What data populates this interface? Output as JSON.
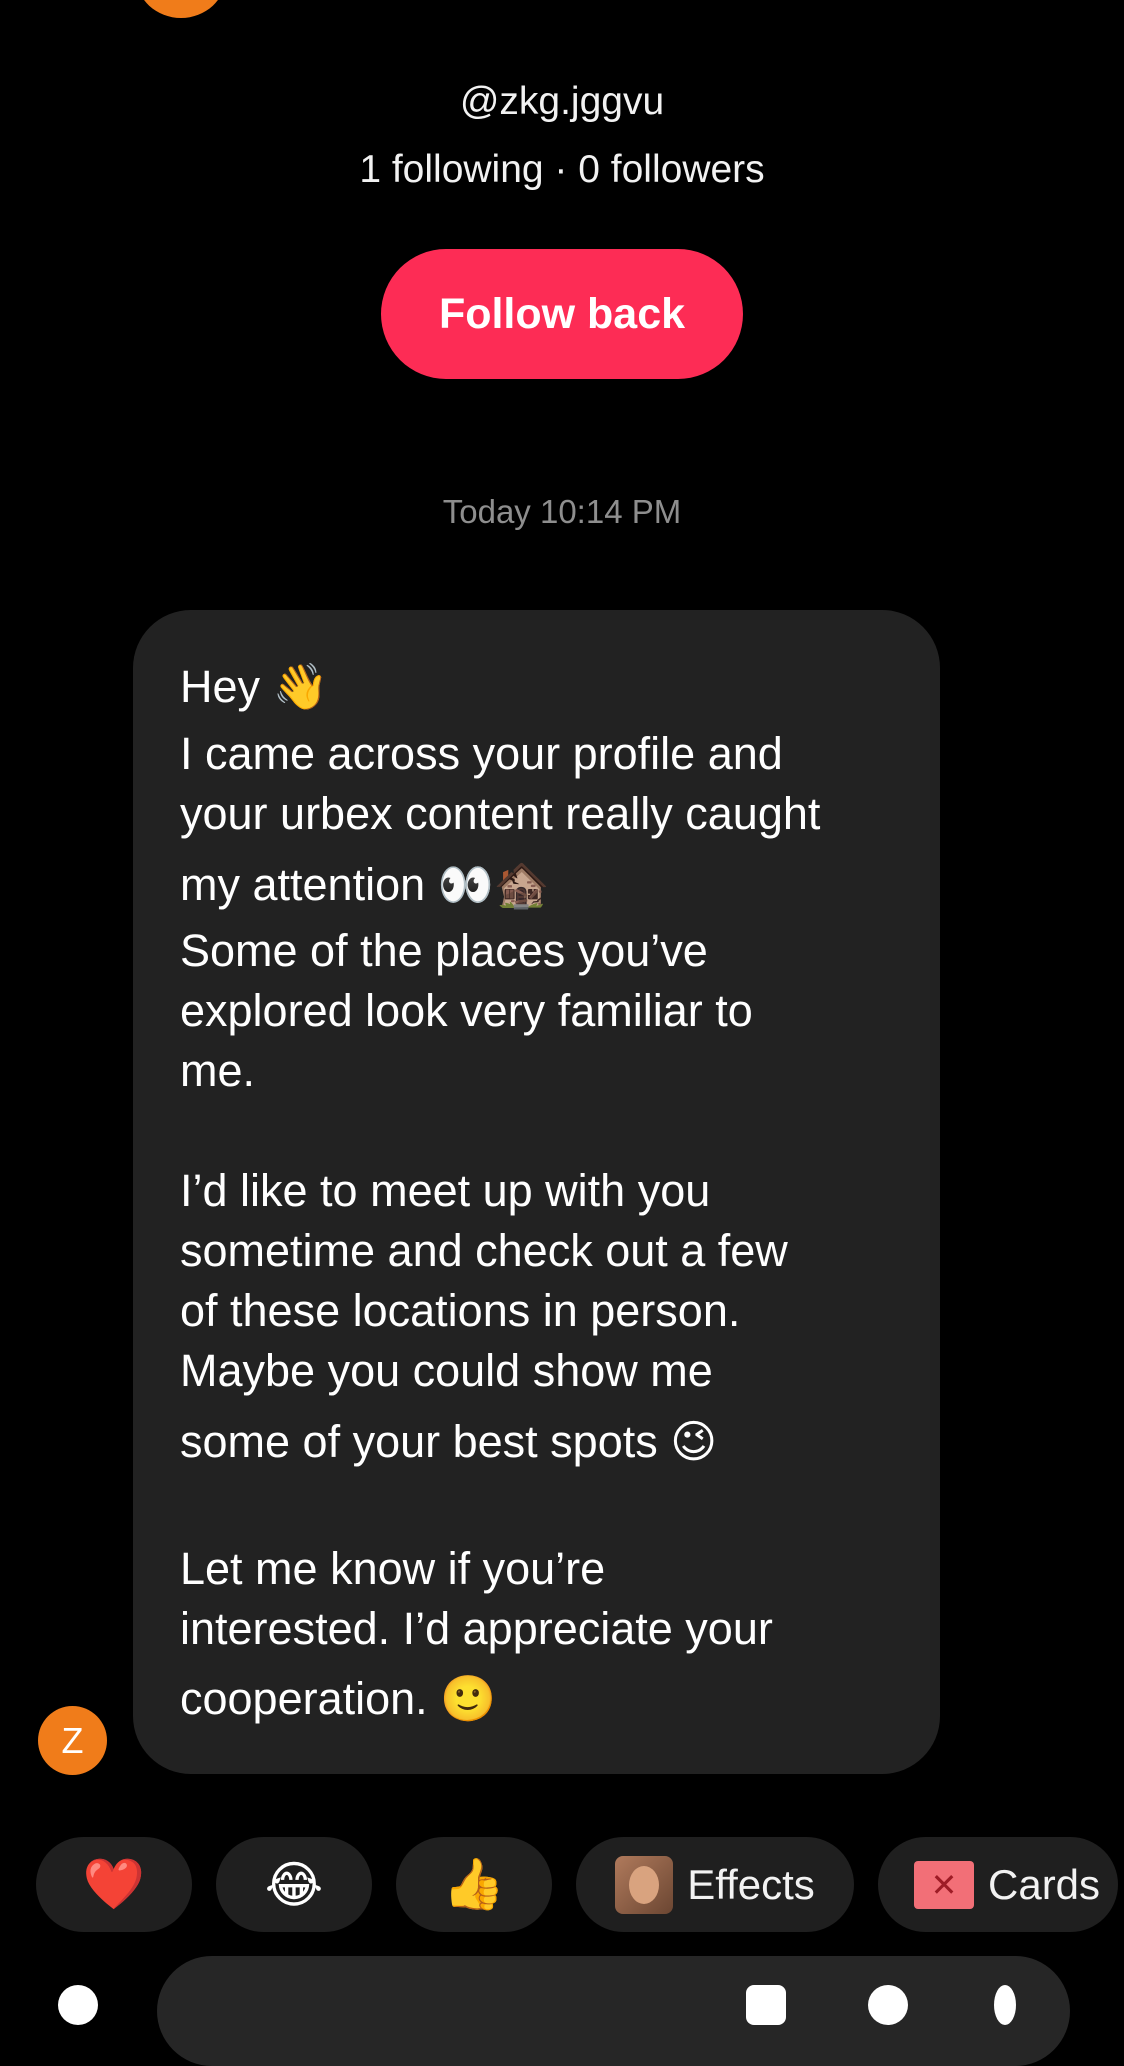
{
  "profile": {
    "handle": "@zkg.jggvu",
    "stats": "1 following · 0 followers",
    "follow_button_label": "Follow back",
    "avatar_color": "#f07c1a"
  },
  "conversation": {
    "timestamp": "Today 10:14 PM",
    "sender_initial": "Z",
    "message_lines": [
      "Hey 👋",
      "I came across your profile and",
      "your urbex content really caught",
      "my attention 👀🏚️",
      "Some of the places you’ve",
      "explored look very familiar to",
      "me.",
      "I’d like to meet up with you",
      "sometime and check out a few",
      "of these locations in person.",
      "Maybe you could show me",
      "some of your best spots 😉",
      "Let me know if you’re",
      "interested. I’d appreciate your",
      "cooperation. 🙂"
    ]
  },
  "quick_replies": [
    {
      "icon": "heart-icon",
      "emoji": "❤️"
    },
    {
      "icon": "laughing-tears-icon",
      "emoji": "😂"
    },
    {
      "icon": "thumbs-up-icon",
      "emoji": "👍"
    },
    {
      "icon": "effects-icon",
      "label": "Effects"
    },
    {
      "icon": "gift-card-icon",
      "label": "Cards"
    }
  ],
  "colors": {
    "accent": "#fd2c55",
    "bubble": "#222222",
    "chip": "#1f1f1f",
    "background": "#000000"
  }
}
